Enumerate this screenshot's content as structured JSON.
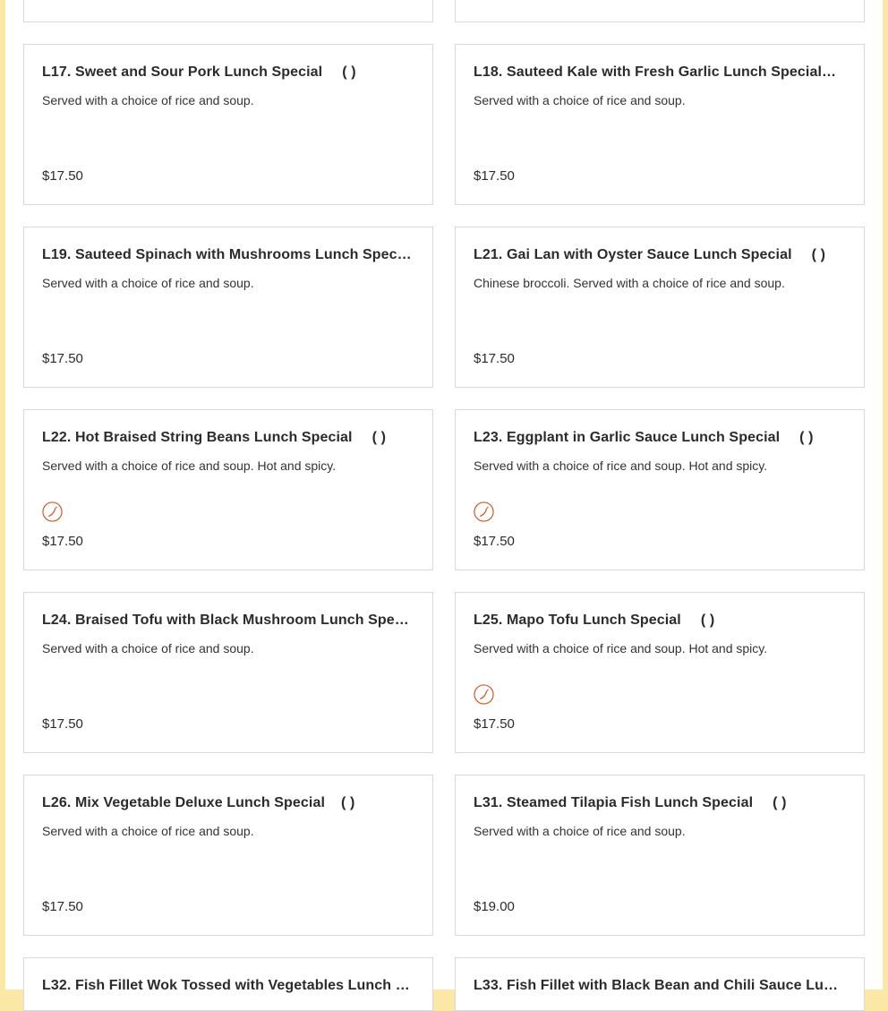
{
  "menu": {
    "items": [
      {
        "name": "L17. Sweet and Sour Pork Lunch Special",
        "paren": "( )",
        "description": "Served with a choice of rice and soup.",
        "price": "$17.50",
        "spicy": false
      },
      {
        "name": "L18. Sauteed Kale with Fresh Garlic Lunch Special",
        "paren": "…",
        "description": "Served with a choice of rice and soup.",
        "price": "$17.50",
        "spicy": false
      },
      {
        "name": "L19. Sauteed Spinach with Mushrooms Lunch Speci…",
        "paren": "",
        "description": "Served with a choice of rice and soup.",
        "price": "$17.50",
        "spicy": false
      },
      {
        "name": "L21. Gai Lan with Oyster Sauce Lunch Special",
        "paren": "( )",
        "description": "Chinese broccoli. Served with a choice of rice and soup.",
        "price": "$17.50",
        "spicy": false
      },
      {
        "name": "L22. Hot Braised String Beans Lunch Special",
        "paren": "( )",
        "description": "Served with a choice of rice and soup. Hot and spicy.",
        "price": "$17.50",
        "spicy": true
      },
      {
        "name": "L23. Eggplant in Garlic Sauce Lunch Special",
        "paren": "( )",
        "description": "Served with a choice of rice and soup. Hot and spicy.",
        "price": "$17.50",
        "spicy": true
      },
      {
        "name": "L24. Braised Tofu with Black Mushroom Lunch Speci…",
        "paren": "",
        "description": "Served with a choice of rice and soup.",
        "price": "$17.50",
        "spicy": false
      },
      {
        "name": "L25. Mapo Tofu Lunch Special",
        "paren": "( )",
        "description": "Served with a choice of rice and soup. Hot and spicy.",
        "price": "$17.50",
        "spicy": true
      },
      {
        "name": "L26. Mix Vegetable Deluxe Lunch Special",
        "paren": "( )",
        "description": "Served with a choice of rice and soup.",
        "price": "$17.50",
        "spicy": false
      },
      {
        "name": "L31. Steamed Tilapia Fish Lunch Special",
        "paren": "( )",
        "description": "Served with a choice of rice and soup.",
        "price": "$19.00",
        "spicy": false
      },
      {
        "name": "L32. Fish Fillet Wok Tossed with Vegetables Lunch S…",
        "paren": "",
        "description": "",
        "price": "",
        "spicy": false
      },
      {
        "name": "L33. Fish Fillet with Black Bean and Chili Sauce Lun…",
        "paren": "",
        "description": "",
        "price": "",
        "spicy": false
      }
    ]
  },
  "colors": {
    "page_background": "#fbe7a6",
    "card_border": "#d9d9d9",
    "spicy_icon": "#d2541e"
  },
  "icons": {
    "spicy": "chili-pepper-icon"
  }
}
